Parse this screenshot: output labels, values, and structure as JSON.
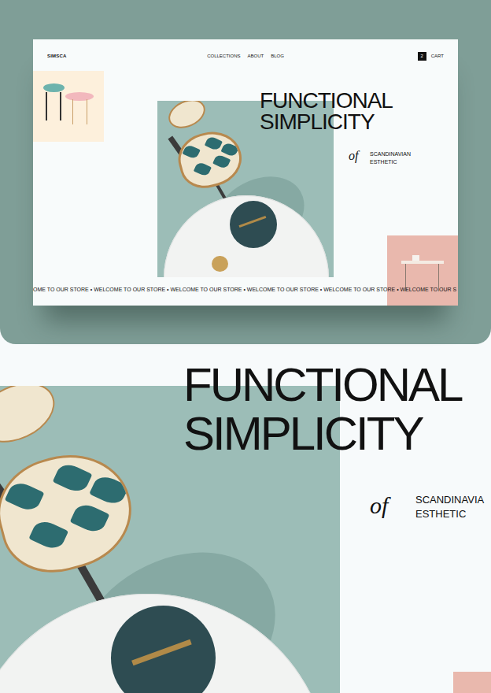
{
  "mockup": {
    "logo": "SIMSCA",
    "nav": [
      {
        "label": "COLLECTIONS"
      },
      {
        "label": "ABOUT"
      },
      {
        "label": "BLOG"
      }
    ],
    "cart_count": "2",
    "cart_label": "CART",
    "headline": [
      "FUNCTIONAL",
      "SIMPLICITY"
    ],
    "of": "of",
    "subline": [
      "SCANDINAVIAN",
      "ESTHETIC"
    ],
    "marquee": "OME TO OUR STORE • WELCOME TO OUR STORE • WELCOME TO OUR STORE • WELCOME TO OUR STORE • WELCOME TO OUR STORE • WELCOME TO OUR S"
  },
  "closeup": {
    "headline": [
      "FUNCTIONAL",
      "SIMPLICITY"
    ],
    "of": "of",
    "subline": [
      "SCANDINAVIA",
      "ESTHETIC"
    ]
  }
}
